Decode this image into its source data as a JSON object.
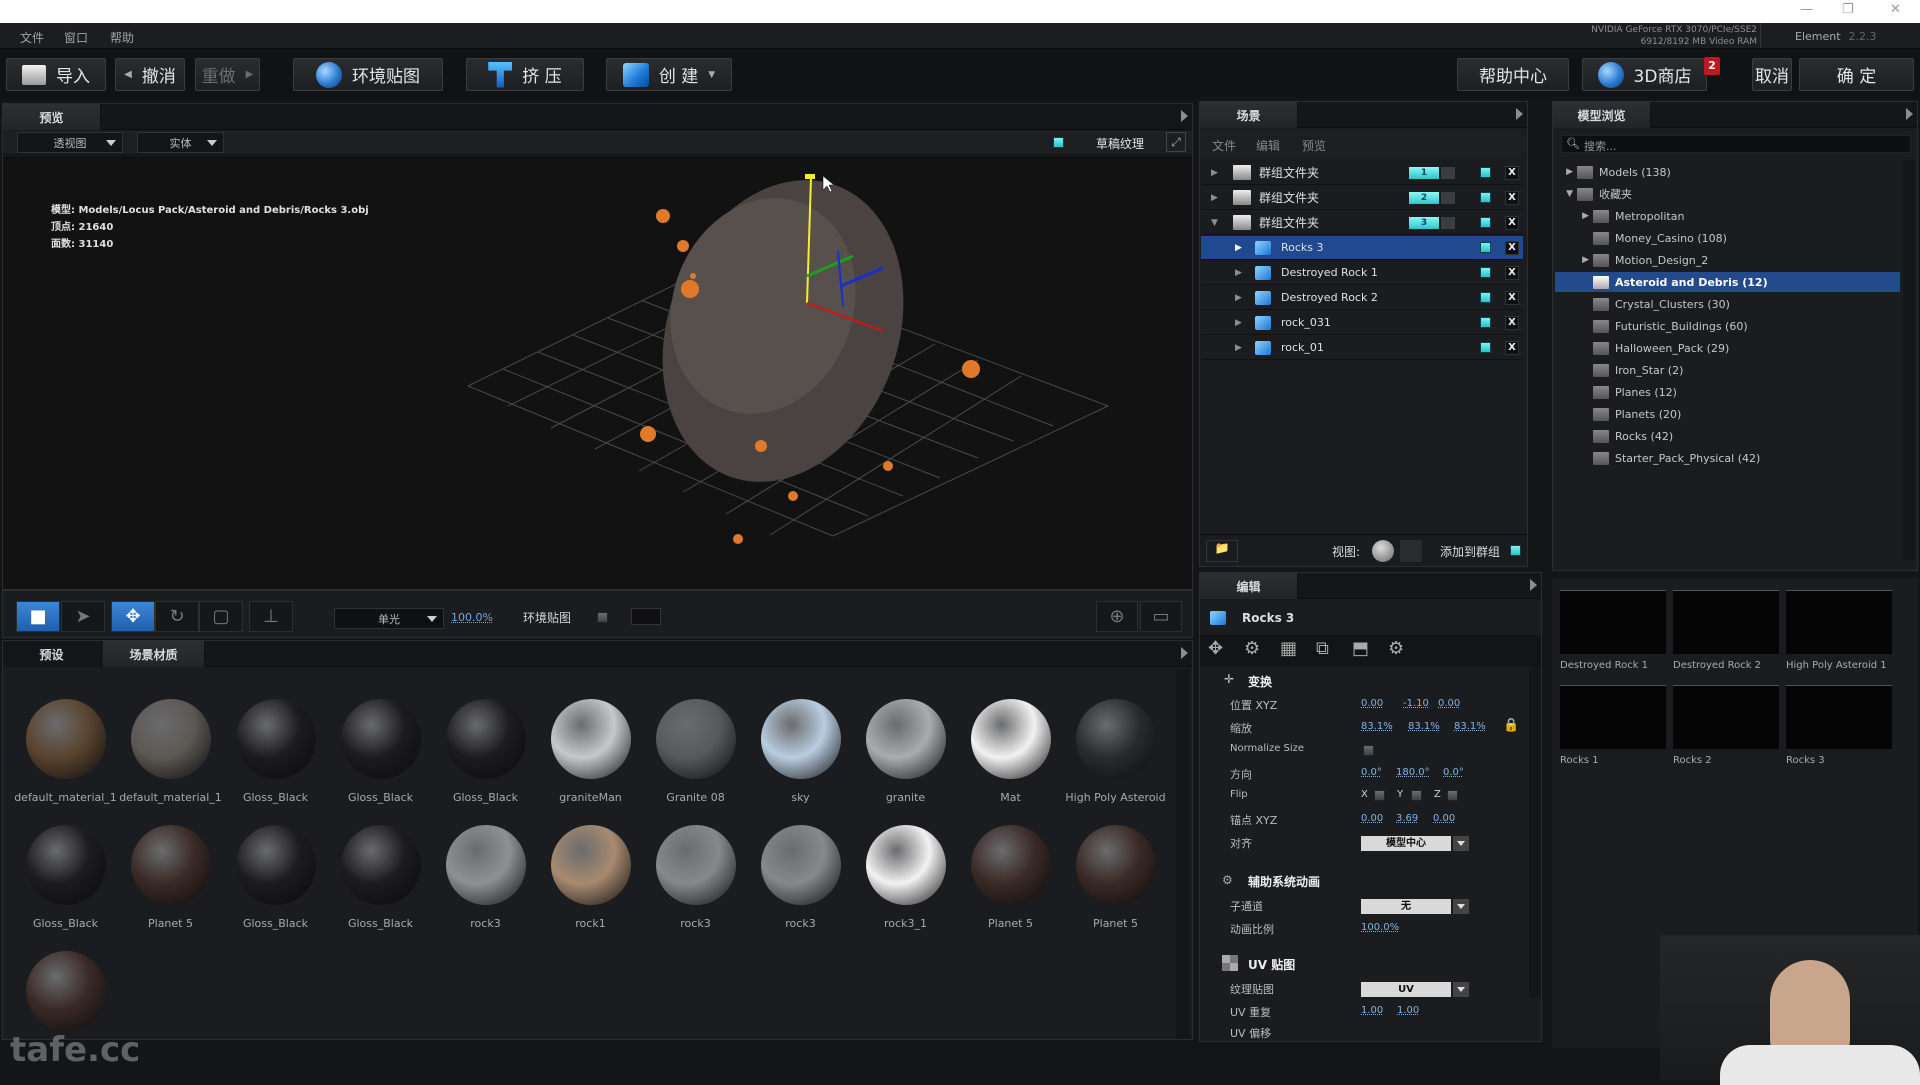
{
  "window": {
    "minimize": "—",
    "restore": "❐",
    "close": "✕"
  },
  "menu": [
    "文件",
    "窗口",
    "帮助"
  ],
  "gpu": {
    "line1": "NVIDIA GeForce RTX 3070/PCIe/SSE2",
    "line2": "6912/8192 MB Video RAM"
  },
  "app": {
    "name": "Element",
    "version": "2.2.3"
  },
  "toolbar": {
    "import": "导入",
    "undo": "撤消",
    "redo": "重做",
    "env_map": "环境贴图",
    "extrude": "挤 压",
    "create": "创 建",
    "help_center": "帮助中心",
    "store": "3D商店",
    "store_badge": "2",
    "cancel": "取消",
    "ok": "确 定"
  },
  "preview": {
    "tab": "预览",
    "view_mode": "透视图",
    "shading": "实体",
    "draft_texture": "草稿纹理",
    "model_label": "模型:",
    "model_path": "Models/Locus Pack/Asteroid and Debris/Rocks 3.obj",
    "verts_label": "顶点:",
    "verts": "21640",
    "faces_label": "面数:",
    "faces": "31140"
  },
  "viewport_tools": {
    "light_mode": "单光",
    "light_value": "100.0%",
    "env_map_label": "环境贴图"
  },
  "materials": {
    "tabs": [
      "预设",
      "场景材质"
    ],
    "items": [
      {
        "name": "default_material_1",
        "color": "#5a4430"
      },
      {
        "name": "default_material_1",
        "color": "#5c5853"
      },
      {
        "name": "Gloss_Black",
        "color": "#1c1c1e"
      },
      {
        "name": "Gloss_Black",
        "color": "#1c1c1e"
      },
      {
        "name": "Gloss_Black",
        "color": "#1c1c1e"
      },
      {
        "name": "graniteMan",
        "color": "#c6c8cb"
      },
      {
        "name": "Granite 08",
        "color": "#58595b"
      },
      {
        "name": "sky",
        "color": "#b9cde0"
      },
      {
        "name": "granite",
        "color": "#a9abad"
      },
      {
        "name": "Mat",
        "color": "#f2f2f2"
      },
      {
        "name": "High Poly Asteroid",
        "color": "#2a2b2c"
      },
      {
        "name": "Gloss_Black",
        "color": "#1c1c1e"
      },
      {
        "name": "Planet 5",
        "color": "#3a2a26"
      },
      {
        "name": "Gloss_Black",
        "color": "#1c1c1e"
      },
      {
        "name": "Gloss_Black",
        "color": "#1c1c1e"
      },
      {
        "name": "rock3",
        "color": "#8e9194"
      },
      {
        "name": "rock1",
        "color": "#a88a70"
      },
      {
        "name": "rock3",
        "color": "#86898c"
      },
      {
        "name": "rock3",
        "color": "#86898c"
      },
      {
        "name": "rock3_1",
        "color": "#f2f2f2"
      },
      {
        "name": "Planet 5",
        "color": "#3a2a26"
      },
      {
        "name": "Planet 5",
        "color": "#3a2a26"
      },
      {
        "name": "",
        "color": "#3a2a26"
      }
    ]
  },
  "scene": {
    "tab": "场景",
    "menu": [
      "文件",
      "编辑",
      "预览"
    ],
    "rows": [
      {
        "type": "group",
        "name": "群组文件夹",
        "num": "1",
        "expanded": false
      },
      {
        "type": "group",
        "name": "群组文件夹",
        "num": "2",
        "expanded": false
      },
      {
        "type": "group",
        "name": "群组文件夹",
        "num": "3",
        "expanded": true
      },
      {
        "type": "object",
        "name": "Rocks 3",
        "selected": true
      },
      {
        "type": "object",
        "name": "Destroyed Rock 1"
      },
      {
        "type": "object",
        "name": "Destroyed Rock 2"
      },
      {
        "type": "object",
        "name": "rock_031"
      },
      {
        "type": "object",
        "name": "rock_01"
      }
    ],
    "delete_label": "X",
    "view_label": "视图:",
    "add_to_group": "添加到群组"
  },
  "edit": {
    "tab": "编辑",
    "object_name": "Rocks 3",
    "transform": {
      "title": "变换",
      "position_label": "位置 XYZ",
      "position": [
        "0.00",
        "-1.10",
        "0.00"
      ],
      "scale_label": "缩放",
      "scale": [
        "83.1%",
        "83.1%",
        "83.1%"
      ],
      "normalize_label": "Normalize Size",
      "orientation_label": "方向",
      "orientation": [
        "0.0°",
        "180.0°",
        "0.0°"
      ],
      "flip_label": "Flip",
      "flip_axes": [
        "X",
        "Y",
        "Z"
      ],
      "anchor_label": "锚点 XYZ",
      "anchor": [
        "0.00",
        "3.69",
        "0.00"
      ],
      "align_label": "对齐",
      "align": "模型中心"
    },
    "aux_anim": {
      "title": "辅助系统动画",
      "subchannel_label": "子通道",
      "subchannel": "无",
      "anim_scale_label": "动画比例",
      "anim_scale": "100.0%"
    },
    "uv": {
      "title": "UV 贴图",
      "tex_map_label": "纹理贴图",
      "tex_map": "UV",
      "repeat_label": "UV 重复",
      "repeat": [
        "1.00",
        "1.00"
      ],
      "offset_label": "UV 偏移"
    }
  },
  "browser": {
    "tab": "模型浏览",
    "search_placeholder": "搜索...",
    "tree": [
      {
        "name": "Models (138)",
        "level": 0,
        "arrow": "▶"
      },
      {
        "name": "收藏夹",
        "level": 0,
        "arrow": "▼"
      },
      {
        "name": "Metropolitan",
        "level": 1,
        "arrow": "▶"
      },
      {
        "name": "Money_Casino (108)",
        "level": 1,
        "arrow": ""
      },
      {
        "name": "Motion_Design_2",
        "level": 1,
        "arrow": "▶"
      },
      {
        "name": "Asteroid and Debris (12)",
        "level": 1,
        "arrow": "",
        "selected": true
      },
      {
        "name": "Crystal_Clusters (30)",
        "level": 1,
        "arrow": ""
      },
      {
        "name": "Futuristic_Buildings (60)",
        "level": 1,
        "arrow": ""
      },
      {
        "name": "Halloween_Pack (29)",
        "level": 1,
        "arrow": ""
      },
      {
        "name": "Iron_Star (2)",
        "level": 1,
        "arrow": ""
      },
      {
        "name": "Planes (12)",
        "level": 1,
        "arrow": ""
      },
      {
        "name": "Planets (20)",
        "level": 1,
        "arrow": ""
      },
      {
        "name": "Rocks (42)",
        "level": 1,
        "arrow": ""
      },
      {
        "name": "Starter_Pack_Physical (42)",
        "level": 1,
        "arrow": ""
      }
    ],
    "thumbnails": [
      "Destroyed Rock 1",
      "Destroyed Rock 2",
      "High Poly Asteroid 1",
      "Rocks 1",
      "Rocks 2",
      "Rocks 3"
    ]
  },
  "watermark": "tafe.cc",
  "colors": {
    "accent": "#1f4a8f",
    "toggle_on": "#5ee6e6",
    "link_value": "#7fb4e4",
    "badge": "#c0181c"
  }
}
